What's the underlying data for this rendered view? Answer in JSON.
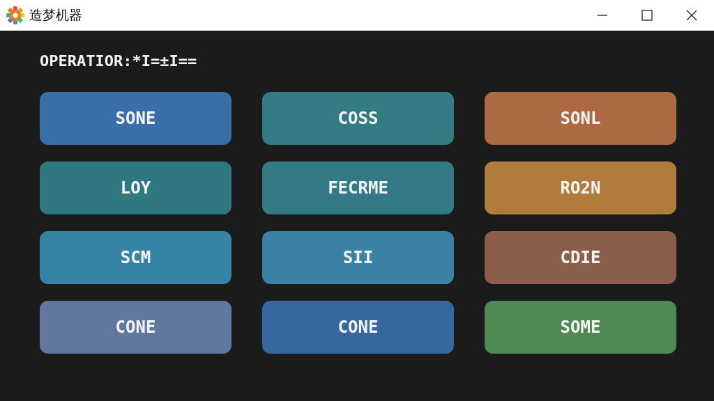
{
  "window": {
    "title": "造梦机器"
  },
  "heading": "OPERATIOR:*I=±I==",
  "buttons": [
    {
      "label": "SONE",
      "color": "#3a6ea8"
    },
    {
      "label": "COSS",
      "color": "#347c84"
    },
    {
      "label": "SONL",
      "color": "#ad6a42"
    },
    {
      "label": "LOY",
      "color": "#30787f"
    },
    {
      "label": "FECRME",
      "color": "#337a86"
    },
    {
      "label": "RO2N",
      "color": "#b07c3e"
    },
    {
      "label": "SCM",
      "color": "#3584a5"
    },
    {
      "label": "SII",
      "color": "#3a82a5"
    },
    {
      "label": "CDIE",
      "color": "#8a5e4a"
    },
    {
      "label": "CONE",
      "color": "#62779f"
    },
    {
      "label": "CONE",
      "color": "#36679f"
    },
    {
      "label": "SOME",
      "color": "#4f8a55"
    }
  ]
}
